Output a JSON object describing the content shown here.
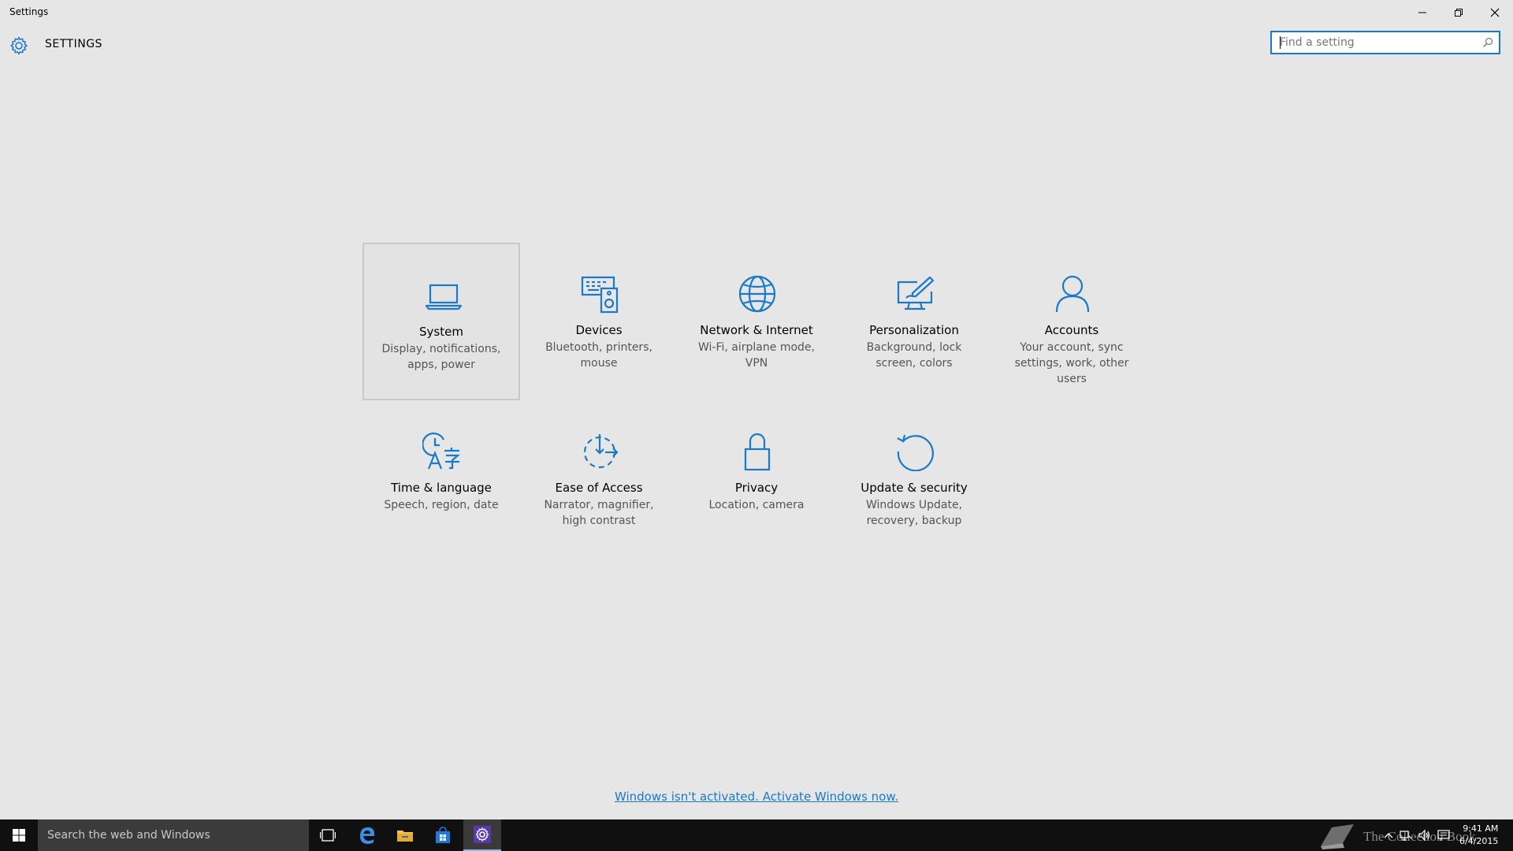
{
  "window": {
    "title": "Settings"
  },
  "header": {
    "title": "SETTINGS"
  },
  "search": {
    "placeholder": "Find a setting",
    "value": ""
  },
  "tiles": [
    {
      "name": "System",
      "desc": "Display, notifications, apps, power",
      "icon": "laptop-icon",
      "selected": true
    },
    {
      "name": "Devices",
      "desc": "Bluetooth, printers, mouse",
      "icon": "devices-icon"
    },
    {
      "name": "Network & Internet",
      "desc": "Wi-Fi, airplane mode, VPN",
      "icon": "globe-icon"
    },
    {
      "name": "Personalization",
      "desc": "Background, lock screen, colors",
      "icon": "personalization-icon"
    },
    {
      "name": "Accounts",
      "desc": "Your account, sync settings, work, other users",
      "icon": "person-icon"
    },
    {
      "name": "Time & language",
      "desc": "Speech, region, date",
      "icon": "time-language-icon"
    },
    {
      "name": "Ease of Access",
      "desc": "Narrator, magnifier, high contrast",
      "icon": "ease-of-access-icon"
    },
    {
      "name": "Privacy",
      "desc": "Location, camera",
      "icon": "lock-icon"
    },
    {
      "name": "Update & security",
      "desc": "Windows Update, recovery, backup",
      "icon": "refresh-icon"
    }
  ],
  "activation": {
    "text": "Windows isn't activated. Activate Windows now."
  },
  "taskbar": {
    "search_text": "Search the web and Windows",
    "watermark": "The Collection Book",
    "time": "9:41 AM",
    "date": "6/4/2015"
  },
  "colors": {
    "accent": "#1979ca",
    "background": "#e6e6e6",
    "taskbar": "#101010"
  }
}
